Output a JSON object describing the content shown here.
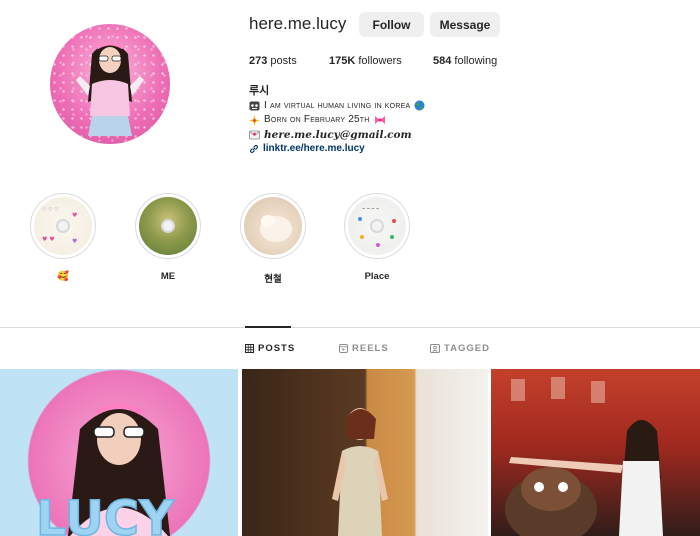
{
  "profile": {
    "username": "here.me.lucy",
    "follow_label": "Follow",
    "message_label": "Message",
    "stats": {
      "posts_count": "273",
      "posts_label": "posts",
      "followers_count": "175K",
      "followers_label": "followers",
      "following_count": "584",
      "following_label": "following"
    },
    "bio": {
      "name": "루시",
      "line1": "I am virtual human living in korea",
      "line2": "Born on February 25th",
      "email": "here.me.lucy@gmail.com",
      "link": "linktr.ee/here.me.lucy"
    }
  },
  "highlights": [
    {
      "label": "🥰",
      "icon": "cd-hearts"
    },
    {
      "label": "ME",
      "icon": "cd-garden"
    },
    {
      "label": "현철",
      "icon": "cd-dog"
    },
    {
      "label": "Place",
      "icon": "cd-stickers"
    }
  ],
  "tabs": [
    {
      "label": "POSTS",
      "icon": "grid-icon",
      "active": true
    },
    {
      "label": "REELS",
      "icon": "reels-icon",
      "active": false
    },
    {
      "label": "TAGGED",
      "icon": "tagged-icon",
      "active": false
    }
  ],
  "colors": {
    "text": "#262626",
    "muted": "#8e8e8e",
    "button_bg": "#efefef",
    "link": "#00376b",
    "divider": "#dbdbdb"
  }
}
